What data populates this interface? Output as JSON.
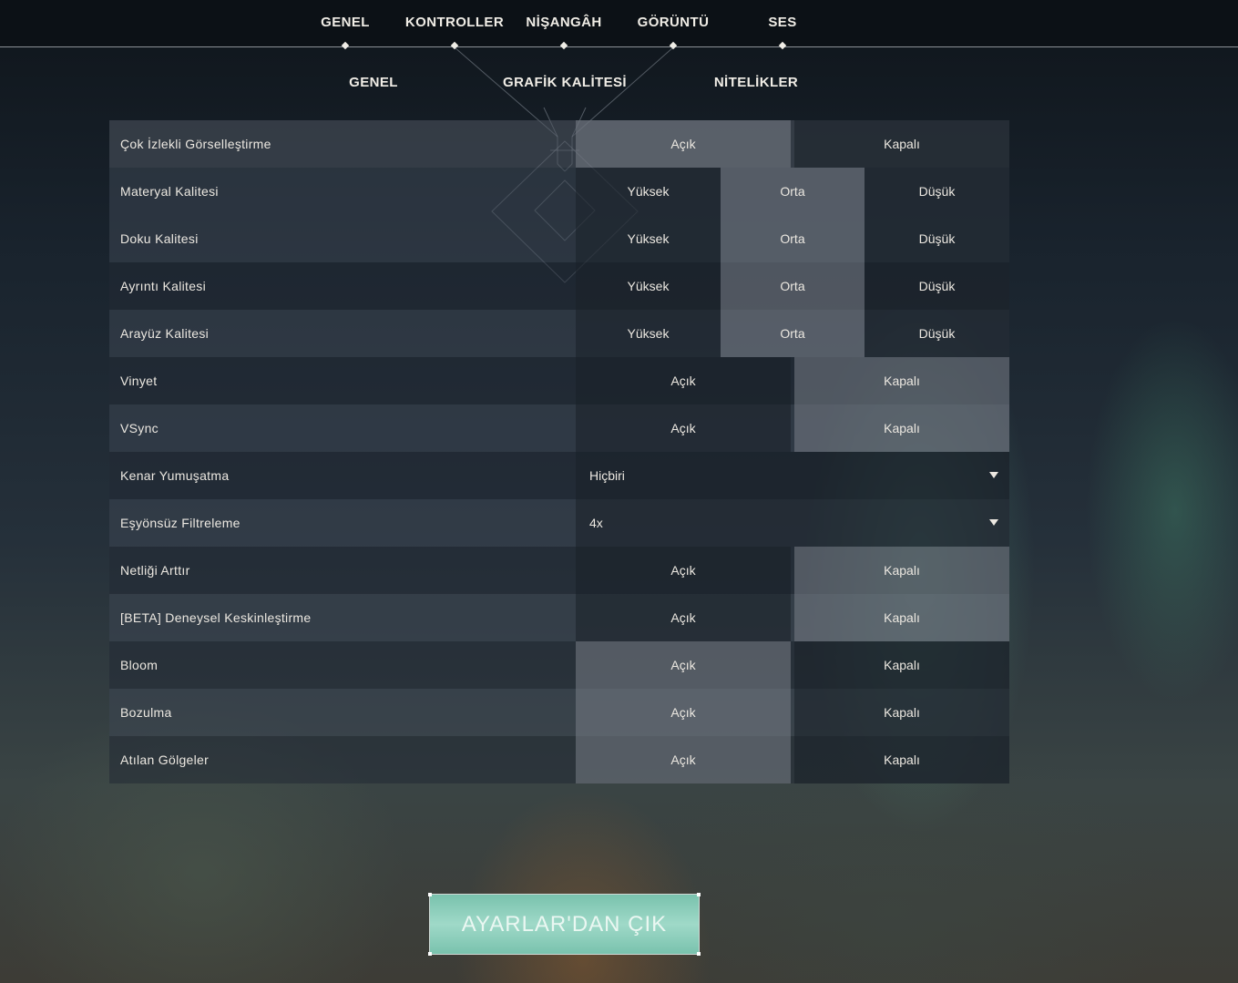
{
  "top_tabs": [
    "GENEL",
    "KONTROLLER",
    "NİŞANGÂH",
    "GÖRÜNTÜ",
    "SES"
  ],
  "sub_tabs": [
    "GENEL",
    "GRAFİK KALİTESİ",
    "NİTELİKLER"
  ],
  "settings": [
    {
      "label": "Çok İzlekli Görselleştirme",
      "options": [
        "Açık",
        "Kapalı"
      ]
    },
    {
      "label": "Materyal Kalitesi",
      "options": [
        "Yüksek",
        "Orta",
        "Düşük"
      ]
    },
    {
      "label": "Doku Kalitesi",
      "options": [
        "Yüksek",
        "Orta",
        "Düşük"
      ]
    },
    {
      "label": "Ayrıntı Kalitesi",
      "options": [
        "Yüksek",
        "Orta",
        "Düşük"
      ]
    },
    {
      "label": "Arayüz Kalitesi",
      "options": [
        "Yüksek",
        "Orta",
        "Düşük"
      ]
    },
    {
      "label": "Vinyet",
      "options": [
        "Açık",
        "Kapalı"
      ]
    },
    {
      "label": "VSync",
      "options": [
        "Açık",
        "Kapalı"
      ]
    },
    {
      "label": "Kenar Yumuşatma",
      "value": "Hiçbiri"
    },
    {
      "label": "Eşyönsüz Filtreleme",
      "value": "4x"
    },
    {
      "label": "Netliği Arttır",
      "options": [
        "Açık",
        "Kapalı"
      ]
    },
    {
      "label": "[BETA] Deneysel Keskinleştirme",
      "options": [
        "Açık",
        "Kapalı"
      ]
    },
    {
      "label": "Bloom",
      "options": [
        "Açık",
        "Kapalı"
      ]
    },
    {
      "label": "Bozulma",
      "options": [
        "Açık",
        "Kapalı"
      ]
    },
    {
      "label": "Atılan Gölgeler",
      "options": [
        "Açık",
        "Kapalı"
      ]
    }
  ],
  "exit_button": "AYARLAR'DAN ÇIK"
}
